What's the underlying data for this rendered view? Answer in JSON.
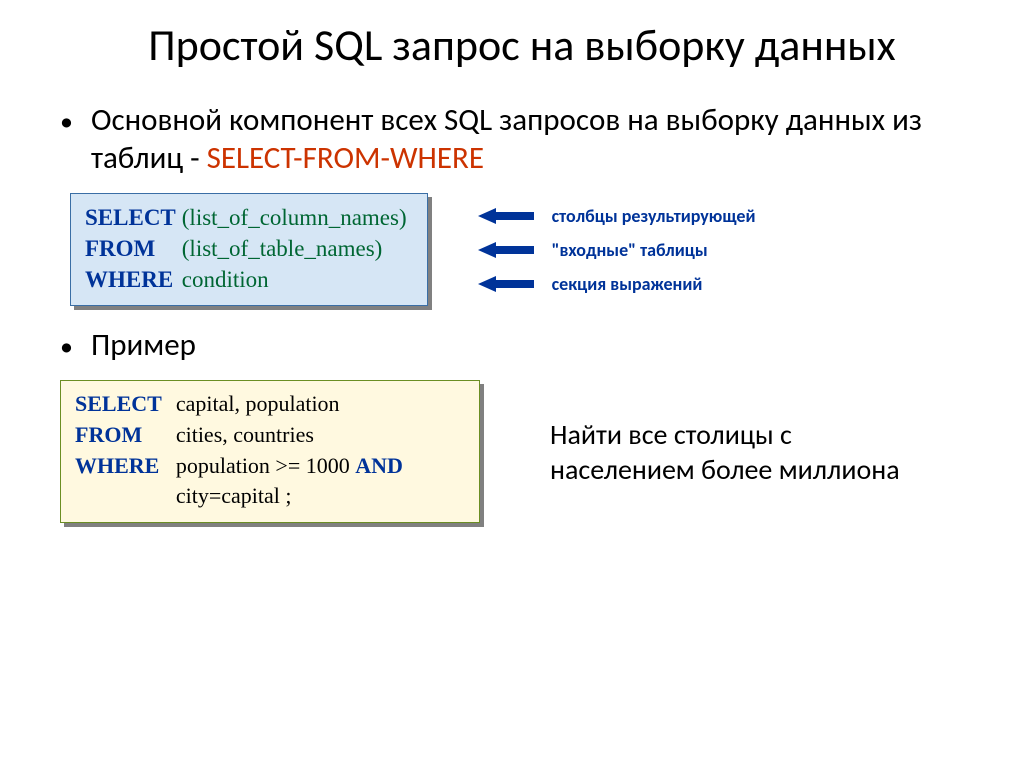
{
  "title": "Простой SQL запрос на выборку данных",
  "bullet1_prefix": "Основной компонент всех SQL запросов на выборку данных из таблиц - ",
  "bullet1_red": "SELECT-FROM-WHERE",
  "syntax": {
    "select_kw": "SELECT",
    "select_arg": "(list_of_column_names)",
    "from_kw": "FROM",
    "from_arg": "(list_of_table_names)",
    "where_kw": "WHERE",
    "where_arg": "condition"
  },
  "arrows": {
    "a1": "столбцы результирующей",
    "a2": "\"входные\" таблицы",
    "a3": "секция выражений"
  },
  "bullet2": "Пример",
  "example": {
    "select_kw": "SELECT",
    "select_arg": "capital, population",
    "from_kw": "FROM",
    "from_arg": "cities, countries",
    "where_kw": "WHERE",
    "where_arg_1": "population  >=  1000 ",
    "where_and": "AND",
    "where_arg_2": "city=capital ;"
  },
  "example_desc": "Найти все столицы с населением более миллиона"
}
